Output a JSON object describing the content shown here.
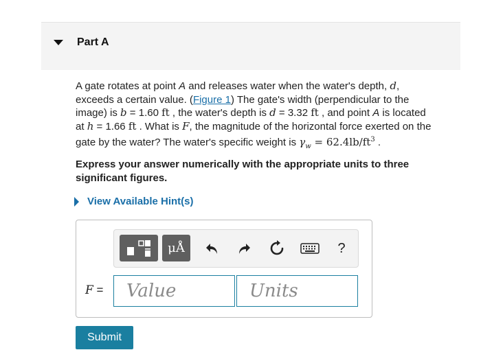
{
  "part": {
    "title": "Part A"
  },
  "problem": {
    "t1": "A gate rotates at point ",
    "v_A1": "A",
    "t2": " and releases water when the water's depth, ",
    "v_d1": "d",
    "t3": ",",
    "t4": "exceeds a certain value. (",
    "figure_link": "Figure 1",
    "t5": ") The gate's width (perpendicular to the",
    "t6": "image) is ",
    "v_b": "b",
    "t7": " = 1.60 ",
    "u_ft1": "ft",
    "t8": " , the water's depth is ",
    "v_d2": "d",
    "t9": " = 3.32 ",
    "u_ft2": "ft",
    "t10": " , and point ",
    "v_A2": "A",
    "t11": " is located",
    "t12": "at ",
    "v_h": "h",
    "t13": " = 1.66 ",
    "u_ft3": "ft",
    "t14": " . What is ",
    "v_F": "F",
    "t15": ", the magnitude of the horizontal force exerted on the",
    "t16": "gate by the water? The water's specific weight is ",
    "v_gamma": "γ",
    "v_w": "w",
    "eq": " = 62.4lb/ft",
    "sup3": "3",
    "t17": " ."
  },
  "instruction": "Express your answer numerically with the appropriate units to three significant figures.",
  "hint": {
    "label": "View Available Hint(s)"
  },
  "toolbar": {
    "units_symbol": "μÅ",
    "undo_icon": "undo-icon",
    "redo_icon": "redo-icon",
    "reset_icon": "reset-icon",
    "keyboard_icon": "keyboard-icon",
    "help_label": "?"
  },
  "answer": {
    "variable": "F",
    "equals": " =",
    "value_placeholder": "Value",
    "units_placeholder": "Units"
  },
  "submit": {
    "label": "Submit"
  },
  "colors": {
    "accent": "#1a7fa0",
    "link": "#1a6fa8",
    "header_bg": "#f4f4f4",
    "toolbar_dark": "#5f5f5f"
  }
}
